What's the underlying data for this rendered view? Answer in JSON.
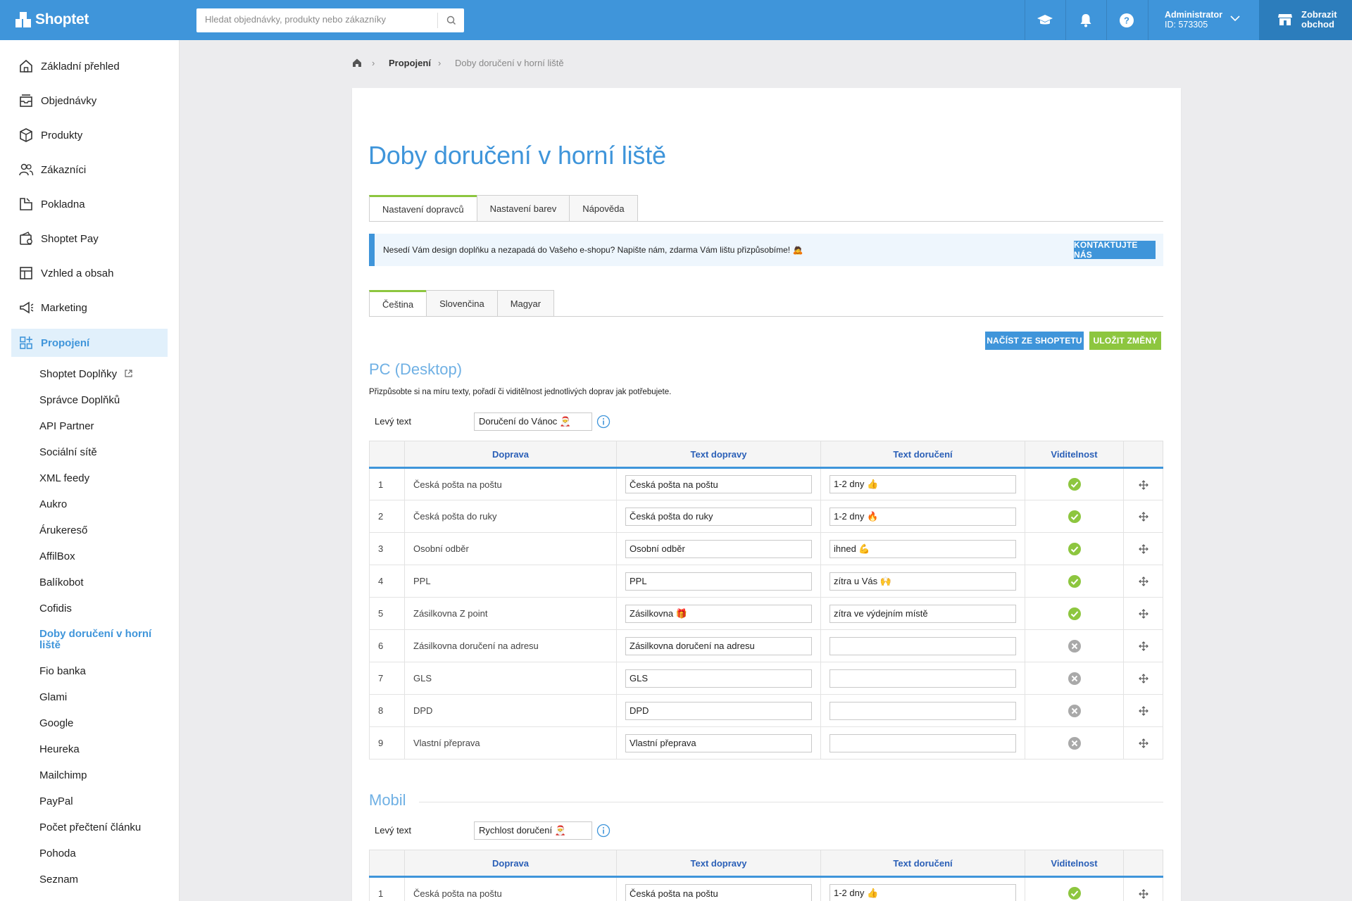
{
  "topbar": {
    "brand": "Shoptet",
    "search_placeholder": "Hledat objednávky, produkty nebo zákazníky",
    "admin_name": "Administrator",
    "admin_id": "ID: 573305",
    "shop_button": "Zobrazit obchod",
    "colors": {
      "bar": "#3f95da",
      "shop_button": "#2c7dbc"
    }
  },
  "sidebar": {
    "items": [
      {
        "label": "Základní přehled",
        "icon": "home-icon"
      },
      {
        "label": "Objednávky",
        "icon": "inbox-icon"
      },
      {
        "label": "Produkty",
        "icon": "box-icon"
      },
      {
        "label": "Zákazníci",
        "icon": "users-icon"
      },
      {
        "label": "Pokladna",
        "icon": "register-icon"
      },
      {
        "label": "Shoptet Pay",
        "icon": "wallet-icon"
      },
      {
        "label": "Vzhled a obsah",
        "icon": "layout-icon"
      },
      {
        "label": "Marketing",
        "icon": "megaphone-icon"
      },
      {
        "label": "Propojení",
        "icon": "apps-icon"
      }
    ],
    "subitems": [
      "Shoptet Doplňky",
      "Správce Doplňků",
      "API Partner",
      "Sociální sítě",
      "XML feedy",
      "Aukro",
      "Árukereső",
      "AffilBox",
      "Balíkobot",
      "Cofidis",
      "Doby doručení v horní liště",
      "Fio banka",
      "Glami",
      "Google",
      "Heureka",
      "Mailchimp",
      "PayPal",
      "Počet přečtení článku",
      "Pohoda",
      "Seznam"
    ]
  },
  "breadcrumb": {
    "parent": "Propojení",
    "current": "Doby doručení v horní liště"
  },
  "page": {
    "title": "Doby doručení v horní liště",
    "tabs": [
      "Nastavení dopravců",
      "Nastavení barev",
      "Nápověda"
    ],
    "alert_text": "Nesedí Vám design doplňku a nezapadá do Vašeho e-shopu? Napište nám, zdarma Vám lištu přizpůsobíme! 🙇",
    "alert_button": "KONTAKTUJTE NÁS",
    "lang_tabs": [
      "Čeština",
      "Slovenčina",
      "Magyar"
    ],
    "load_button": "NAČÍST ZE SHOPTETU",
    "save_button": "ULOŽIT ZMĚNY"
  },
  "desktop": {
    "heading": "PC (Desktop)",
    "description": "Přizpůsobte si na míru texty, pořadí či viditělnost jednotlivých doprav jak potřebujete.",
    "left_text_label": "Levý text",
    "left_text_value": "Doručení do Vánoc 🎅",
    "columns": [
      "Doprava",
      "Text dopravy",
      "Text doručení",
      "Viditelnost"
    ],
    "rows": [
      {
        "num": "1",
        "name": "Česká pošta na poštu",
        "text": "Česká pošta na poštu",
        "delivery": "1-2 dny 👍",
        "visible": true
      },
      {
        "num": "2",
        "name": "Česká pošta do ruky",
        "text": "Česká pošta do ruky",
        "delivery": "1-2 dny 🔥",
        "visible": true
      },
      {
        "num": "3",
        "name": "Osobní odběr",
        "text": "Osobní odběr",
        "delivery": "ihned 💪",
        "visible": true
      },
      {
        "num": "4",
        "name": "PPL",
        "text": "PPL",
        "delivery": "zítra u Vás 🙌",
        "visible": true
      },
      {
        "num": "5",
        "name": "Zásilkovna Z point",
        "text": "Zásilkovna 🎁",
        "delivery": "zítra ve výdejním místě",
        "visible": true
      },
      {
        "num": "6",
        "name": "Zásilkovna doručení na adresu",
        "text": "Zásilkovna doručení na adresu",
        "delivery": "",
        "visible": false
      },
      {
        "num": "7",
        "name": "GLS",
        "text": "GLS",
        "delivery": "",
        "visible": false
      },
      {
        "num": "8",
        "name": "DPD",
        "text": "DPD",
        "delivery": "",
        "visible": false
      },
      {
        "num": "9",
        "name": "Vlastní přeprava",
        "text": "Vlastní přeprava",
        "delivery": "",
        "visible": false
      }
    ]
  },
  "mobile": {
    "heading": "Mobil",
    "left_text_label": "Levý text",
    "left_text_value": "Rychlost doručení 🎅",
    "columns": [
      "Doprava",
      "Text dopravy",
      "Text doručení",
      "Viditelnost"
    ],
    "rows": [
      {
        "num": "1",
        "name": "Česká pošta na poštu",
        "text": "Česká pošta na poštu",
        "delivery": "1-2 dny 👍",
        "visible": true
      }
    ]
  }
}
